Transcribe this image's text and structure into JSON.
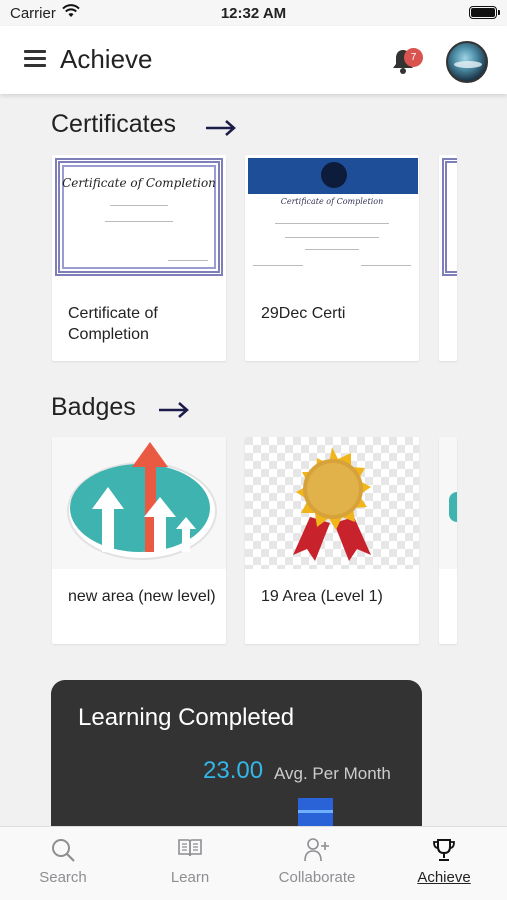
{
  "status_bar": {
    "carrier": "Carrier",
    "time": "12:32 AM"
  },
  "header": {
    "title": "Achieve",
    "notification_count": "7"
  },
  "certificates": {
    "title": "Certificates",
    "items": [
      {
        "label": "Certificate of Completion",
        "image_text": "Certificate of Completion"
      },
      {
        "label": "29Dec Certi",
        "image_text": "Certificate of Completion"
      }
    ]
  },
  "badges": {
    "title": "Badges",
    "items": [
      {
        "label": "new area (new level)"
      },
      {
        "label": "19 Area (Level 1)"
      }
    ]
  },
  "learning": {
    "title": "Learning Completed",
    "value": "23.00",
    "unit": "Avg. Per Month"
  },
  "tabs": [
    {
      "label": "Search",
      "icon": "search-icon"
    },
    {
      "label": "Learn",
      "icon": "book-icon"
    },
    {
      "label": "Collaborate",
      "icon": "add-user-icon"
    },
    {
      "label": "Achieve",
      "icon": "trophy-icon",
      "active": true
    }
  ],
  "colors": {
    "accent_blue": "#33b6e8",
    "dark_card": "#333333",
    "badge_red": "#d9534f"
  }
}
